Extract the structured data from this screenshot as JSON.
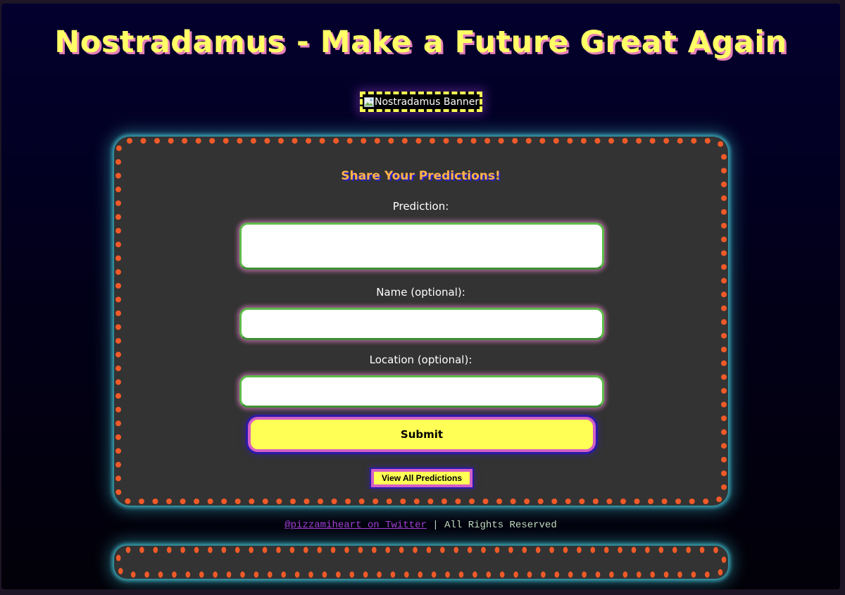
{
  "page": {
    "title": "Nostradamus - Make a Future Great Again",
    "banner_alt": "Nostradamus Banner"
  },
  "form": {
    "heading": "Share Your Predictions!",
    "fields": [
      {
        "label": "Prediction:",
        "value": "",
        "placeholder": ""
      },
      {
        "label": "Name (optional):",
        "value": "",
        "placeholder": ""
      },
      {
        "label": "Location (optional):",
        "value": "",
        "placeholder": ""
      }
    ],
    "submit_label": "Submit",
    "view_all_label": "View All Predictions"
  },
  "footer": {
    "link_text": "@pizzamiheart on Twitter",
    "separator": " | ",
    "rights_text": "All Rights Reserved"
  },
  "colors": {
    "title": "#ffff66",
    "title_shadow": "#e57fb8",
    "heading": "#ffb347",
    "card_bg": "#333333",
    "dot_border": "#f05a28",
    "card_glow": "#3aa6b6",
    "input_border": "#5dbb4a",
    "button_bg": "#ffff55",
    "button_border": "#d35fc5",
    "link": "#a23fd4"
  }
}
